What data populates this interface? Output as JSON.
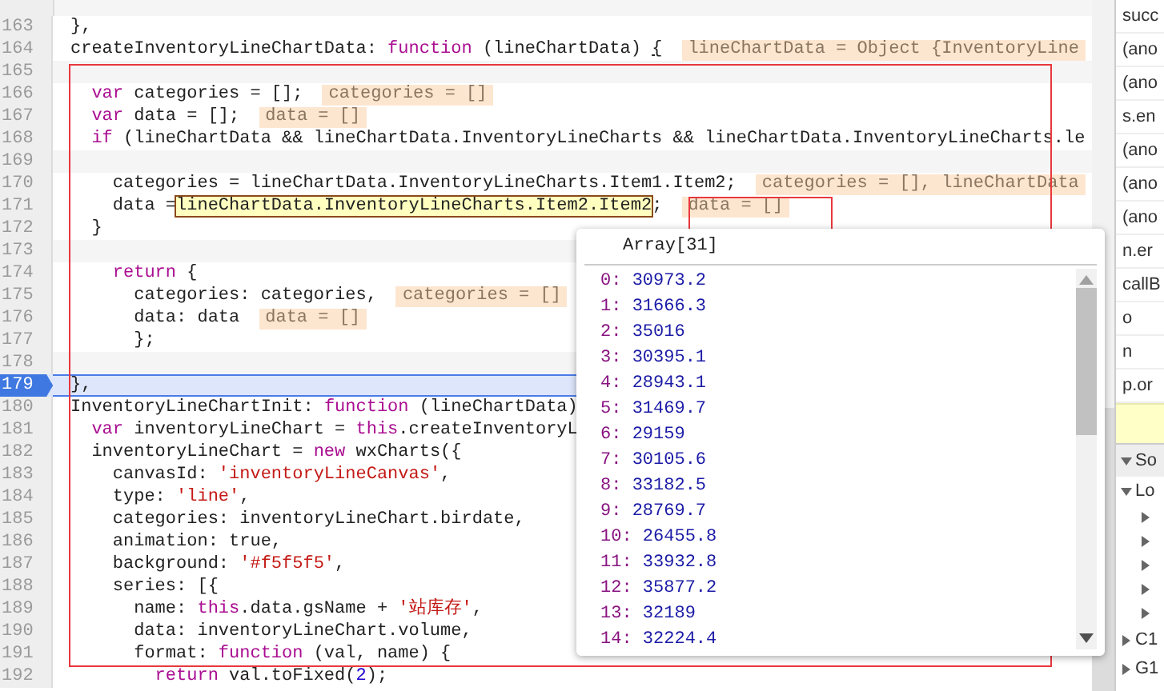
{
  "editor": {
    "lines": [
      {
        "number": "163",
        "current": false,
        "tokens": [
          {
            "kind": "plain",
            "text": "},"
          }
        ]
      },
      {
        "number": "164",
        "current": false,
        "tokens": [
          {
            "kind": "plain",
            "text": "createInventoryLineChartData: "
          },
          {
            "kind": "keyword",
            "text": "function"
          },
          {
            "kind": "plain",
            "text": " (lineChartData) "
          },
          {
            "kind": "underline",
            "text": "{"
          }
        ],
        "value": "lineChartData = Object {InventoryLine"
      },
      {
        "number": "165",
        "current": false
      },
      {
        "number": "166",
        "current": false,
        "tokens": [
          {
            "kind": "keyword",
            "text": "  var"
          },
          {
            "kind": "plain",
            "text": " categories = [];"
          }
        ],
        "value": "categories = []"
      },
      {
        "number": "167",
        "current": false,
        "tokens": [
          {
            "kind": "keyword",
            "text": "  var"
          },
          {
            "kind": "plain",
            "text": " data = [];"
          }
        ],
        "value": "data = []"
      },
      {
        "number": "168",
        "current": false,
        "tokens": [
          {
            "kind": "keyword",
            "text": "  if"
          },
          {
            "kind": "plain",
            "text": " (lineChartData && lineChartData.InventoryLineCharts && lineChartData.InventoryLineCharts.le"
          }
        ]
      },
      {
        "number": "169",
        "current": false
      },
      {
        "number": "170",
        "current": false,
        "tokens": [
          {
            "kind": "plain",
            "text": "    categories = lineChartData.InventoryLineCharts.Item1.Item2;"
          }
        ],
        "value": "categories = [], lineChartData"
      },
      {
        "number": "171",
        "current": false,
        "tokens": [
          {
            "kind": "plain",
            "text": "    data ="
          },
          {
            "kind": "hover",
            "text": "lineChartData.InventoryLineCharts.Item2.Item2"
          },
          {
            "kind": "plain",
            "text": ";"
          }
        ],
        "value": "data = []"
      },
      {
        "number": "172",
        "current": false,
        "tokens": [
          {
            "kind": "plain",
            "text": "  }"
          }
        ]
      },
      {
        "number": "173",
        "current": false
      },
      {
        "number": "174",
        "current": false,
        "tokens": [
          {
            "kind": "keyword",
            "text": "    return"
          },
          {
            "kind": "plain",
            "text": " {"
          }
        ]
      },
      {
        "number": "175",
        "current": false,
        "tokens": [
          {
            "kind": "plain",
            "text": "      categories: categories,"
          }
        ],
        "value": "categories = []"
      },
      {
        "number": "176",
        "current": false,
        "tokens": [
          {
            "kind": "plain",
            "text": "      data: data"
          }
        ],
        "value": "data = []"
      },
      {
        "number": "177",
        "current": false,
        "tokens": [
          {
            "kind": "plain",
            "text": "      };"
          }
        ]
      },
      {
        "number": "178",
        "current": false
      },
      {
        "number": "179",
        "current": true,
        "tokens": [
          {
            "kind": "plain",
            "text": "},"
          }
        ]
      },
      {
        "number": "180",
        "current": false,
        "tokens": [
          {
            "kind": "plain",
            "text": "InventoryLineChartInit: "
          },
          {
            "kind": "keyword",
            "text": "function"
          },
          {
            "kind": "plain",
            "text": " (lineChartData)"
          }
        ]
      },
      {
        "number": "181",
        "current": false,
        "tokens": [
          {
            "kind": "keyword",
            "text": "  var"
          },
          {
            "kind": "plain",
            "text": " inventoryLineChart = "
          },
          {
            "kind": "keyword",
            "text": "this"
          },
          {
            "kind": "plain",
            "text": ".createInventoryL"
          }
        ]
      },
      {
        "number": "182",
        "current": false,
        "tokens": [
          {
            "kind": "plain",
            "text": "  inventoryLineChart = "
          },
          {
            "kind": "keyword",
            "text": "new"
          },
          {
            "kind": "plain",
            "text": " wxCharts({"
          }
        ]
      },
      {
        "number": "183",
        "current": false,
        "tokens": [
          {
            "kind": "plain",
            "text": "    canvasId: "
          },
          {
            "kind": "string",
            "text": "'inventoryLineCanvas'"
          },
          {
            "kind": "plain",
            "text": ","
          }
        ]
      },
      {
        "number": "184",
        "current": false,
        "tokens": [
          {
            "kind": "plain",
            "text": "    type: "
          },
          {
            "kind": "string",
            "text": "'line'"
          },
          {
            "kind": "plain",
            "text": ","
          }
        ]
      },
      {
        "number": "185",
        "current": false,
        "tokens": [
          {
            "kind": "plain",
            "text": "    categories: inventoryLineChart.birdate,"
          }
        ]
      },
      {
        "number": "186",
        "current": false,
        "tokens": [
          {
            "kind": "plain",
            "text": "    animation: true,"
          }
        ]
      },
      {
        "number": "187",
        "current": false,
        "tokens": [
          {
            "kind": "plain",
            "text": "    background: "
          },
          {
            "kind": "string",
            "text": "'#f5f5f5'"
          },
          {
            "kind": "plain",
            "text": ","
          }
        ]
      },
      {
        "number": "188",
        "current": false,
        "tokens": [
          {
            "kind": "plain",
            "text": "    series: [{"
          }
        ]
      },
      {
        "number": "189",
        "current": false,
        "tokens": [
          {
            "kind": "plain",
            "text": "      name: "
          },
          {
            "kind": "keyword",
            "text": "this"
          },
          {
            "kind": "plain",
            "text": ".data.gsName + "
          },
          {
            "kind": "string",
            "text": "'站库存'"
          },
          {
            "kind": "plain",
            "text": ","
          }
        ]
      },
      {
        "number": "190",
        "current": false,
        "tokens": [
          {
            "kind": "plain",
            "text": "      data: inventoryLineChart.volume,"
          }
        ]
      },
      {
        "number": "191",
        "current": false,
        "tokens": [
          {
            "kind": "plain",
            "text": "      format: "
          },
          {
            "kind": "keyword",
            "text": "function"
          },
          {
            "kind": "plain",
            "text": " (val, name) {"
          }
        ]
      },
      {
        "number": "192",
        "current": false,
        "tokens": [
          {
            "kind": "keyword",
            "text": "        return"
          },
          {
            "kind": "plain",
            "text": " val.toFixed("
          },
          {
            "kind": "number",
            "text": "2"
          },
          {
            "kind": "plain",
            "text": ");"
          }
        ]
      }
    ]
  },
  "popup": {
    "title": "Array[31]",
    "entries": [
      {
        "index": "0:",
        "value": "30973.2"
      },
      {
        "index": "1:",
        "value": "31666.3"
      },
      {
        "index": "2:",
        "value": "35016"
      },
      {
        "index": "3:",
        "value": "30395.1"
      },
      {
        "index": "4:",
        "value": "28943.1"
      },
      {
        "index": "5:",
        "value": "31469.7"
      },
      {
        "index": "6:",
        "value": "29159"
      },
      {
        "index": "7:",
        "value": "30105.6"
      },
      {
        "index": "8:",
        "value": "33182.5"
      },
      {
        "index": "9:",
        "value": "28769.7"
      },
      {
        "index": "10:",
        "value": "26455.8"
      },
      {
        "index": "11:",
        "value": "33932.8"
      },
      {
        "index": "12:",
        "value": "35877.2"
      },
      {
        "index": "13:",
        "value": "32189"
      },
      {
        "index": "14:",
        "value": "32224.4"
      }
    ]
  },
  "sidebar": {
    "call_stack": [
      "succ",
      "(ano",
      "(ano",
      "s.en",
      "(ano",
      "(ano",
      "(ano",
      "n.er",
      "callB",
      "o",
      "n",
      "p.or"
    ],
    "scope": {
      "label": "So",
      "expanded": true,
      "children": [
        {
          "label": "Lo",
          "expanded": true,
          "children": [
            {
              "expanded": false
            },
            {
              "expanded": false
            },
            {
              "expanded": false
            },
            {
              "expanded": false
            },
            {
              "expanded": false
            }
          ]
        },
        {
          "label": "C1",
          "expanded": false
        },
        {
          "label": "G1",
          "expanded": false
        }
      ]
    }
  }
}
